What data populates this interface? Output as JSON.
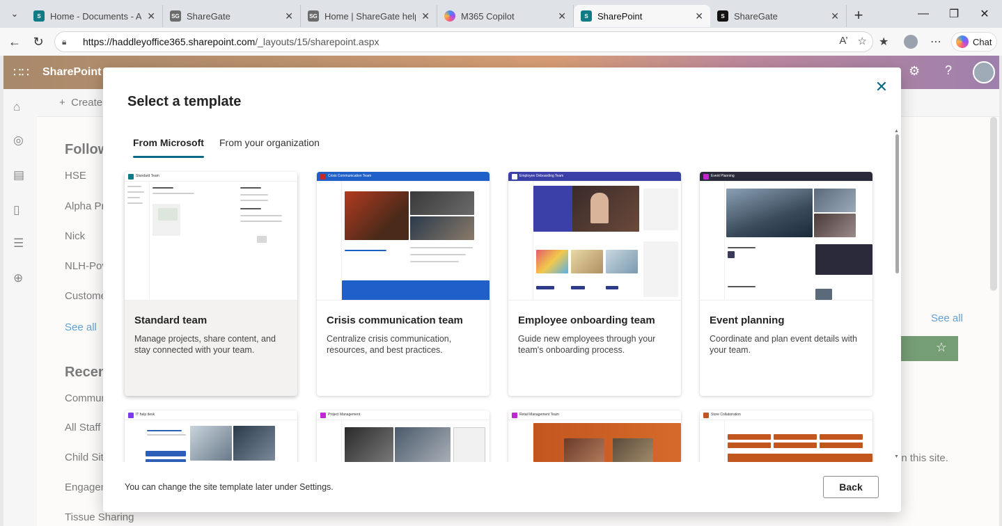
{
  "browser": {
    "tabs": [
      {
        "label": "Home - Documents - All D",
        "fav": "S",
        "fav_color": "#0f7b87"
      },
      {
        "label": "ShareGate",
        "fav": "SG",
        "fav_color": "#6b6b6b"
      },
      {
        "label": "Home | ShareGate help",
        "fav": "SG",
        "fav_color": "#6b6b6b"
      },
      {
        "label": "M365 Copilot",
        "fav": "",
        "fav_color": "#a14ef5"
      },
      {
        "label": "SharePoint",
        "fav": "S",
        "fav_color": "#0f7b87"
      },
      {
        "label": "ShareGate",
        "fav": "",
        "fav_color": "#111111"
      }
    ],
    "active_tab_index": 4,
    "url_host": "https://haddleyoffice365.sharepoint.com",
    "url_path": "/_layouts/15/sharepoint.aspx",
    "chat_label": "Chat"
  },
  "sharepoint": {
    "brand": "SharePoint",
    "create_label": "Create",
    "following_heading": "Follow",
    "following_items": [
      "HSE",
      "Alpha Pr",
      "Nick",
      "NLH-Pov",
      "Custome"
    ],
    "see_all_left": "See all",
    "recent_heading": "Recen",
    "recent_items": [
      "Commur",
      "All Staff",
      "Child Site",
      "Engagem",
      "Tissue Sharing"
    ],
    "see_all_right": "See all",
    "on_this_site": "on this site."
  },
  "dialog": {
    "title": "Select a template",
    "tabs": [
      {
        "label": "From Microsoft",
        "active": true
      },
      {
        "label": "From your organization",
        "active": false
      }
    ],
    "templates": [
      {
        "title": "Standard team",
        "description": "Manage projects, share content, and stay connected with your team.",
        "thumb_name": "Standard Team"
      },
      {
        "title": "Crisis communication team",
        "description": "Centralize crisis communication, resources, and best practices.",
        "thumb_name": "Crisis Communication Team"
      },
      {
        "title": "Employee onboarding team",
        "description": "Guide new employees through your team's onboarding process.",
        "thumb_name": "Employee Onboarding Team"
      },
      {
        "title": "Event planning",
        "description": "Coordinate and plan event details with your team.",
        "thumb_name": "Event Planning"
      }
    ],
    "templates_row2": [
      {
        "thumb_name": "IT help desk"
      },
      {
        "thumb_name": "Project Management"
      },
      {
        "thumb_name": "Retail Management Team"
      },
      {
        "thumb_name": "Store Collaboration"
      }
    ],
    "footer_text": "You can change the site template later under Settings.",
    "back_label": "Back"
  },
  "icons": {
    "tab_menu": "chevron-down-icon",
    "close": "close-icon",
    "back": "arrow-left-icon",
    "refresh": "refresh-icon",
    "lock": "lock-icon",
    "favorite": "star-icon",
    "settings": "gear-icon",
    "help": "question-icon"
  },
  "colors": {
    "accent": "#0b6a83",
    "sp_brand": "#0f7b87",
    "link": "#0f6cbd"
  }
}
